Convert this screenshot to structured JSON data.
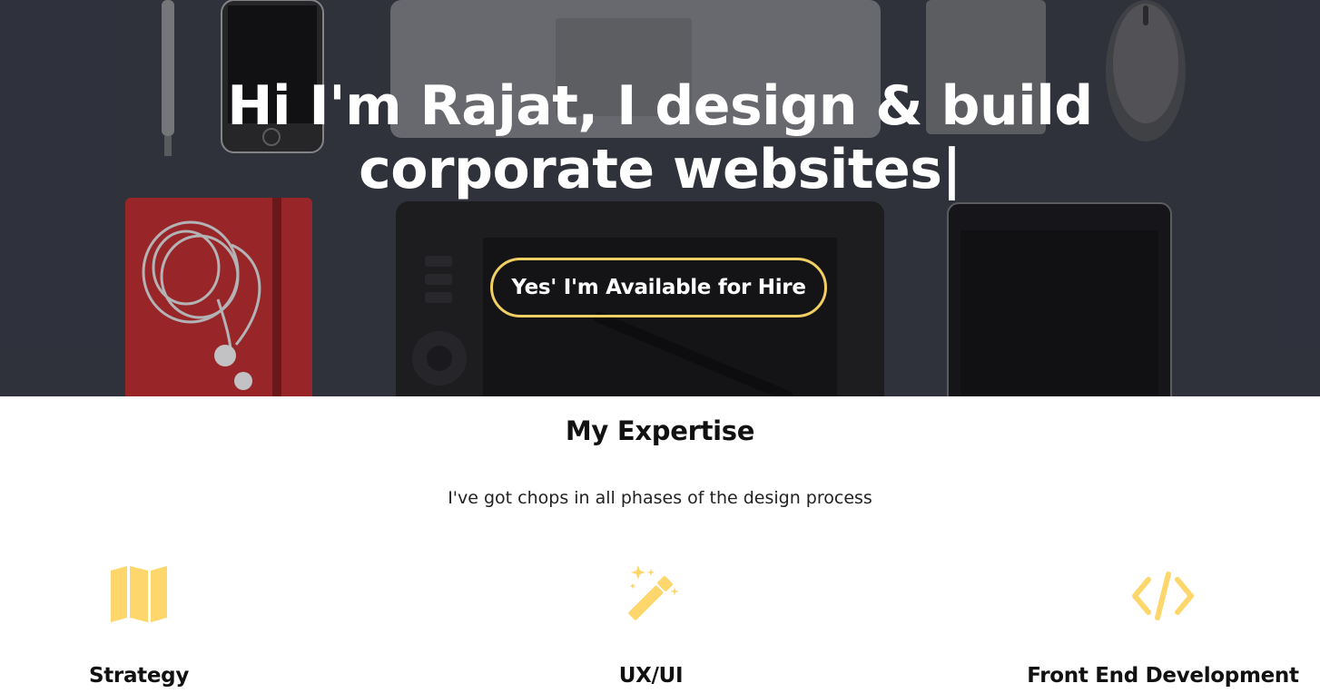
{
  "hero": {
    "title_line1": "Hi I'm Rajat, I design & build",
    "title_line2": "corporate websites",
    "cursor": "|",
    "cta_label": "Yes' I'm Available for Hire"
  },
  "expertise": {
    "title": "My Expertise",
    "subtitle": "I've got chops in all phases of the design process",
    "items": [
      {
        "label": "Strategy",
        "icon": "map-icon"
      },
      {
        "label": "UX/UI",
        "icon": "magic-wand-icon"
      },
      {
        "label": "Front End Development",
        "icon": "code-icon"
      }
    ]
  },
  "colors": {
    "accent": "#f1cf63",
    "icon": "#fdd76b",
    "hero_bg": "#33363f",
    "text_dark": "#111111"
  }
}
